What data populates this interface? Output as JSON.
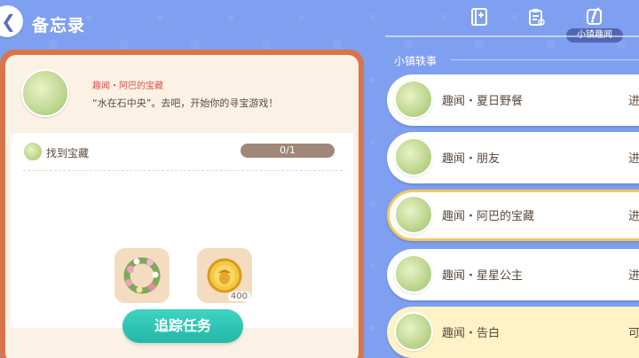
{
  "header": {
    "title": "备忘录",
    "tabs": [
      {
        "icon": "notebook-icon"
      },
      {
        "icon": "clipboard-icon"
      },
      {
        "icon": "note-check-icon",
        "label": "小镇趣闻",
        "active": true
      }
    ]
  },
  "quest": {
    "title": "趣闻・阿巴的宝藏",
    "description": "“水在石中央”。去吧，开始你的寻宝游戏！",
    "task": {
      "label": "找到宝藏",
      "progress": "0/1"
    },
    "rewards": [
      {
        "icon": "flower-wreath-icon",
        "count": ""
      },
      {
        "icon": "gold-acorn-coin-icon",
        "count": "400"
      }
    ],
    "track_button": "追踪任务"
  },
  "list": {
    "section_title": "小镇轶事",
    "items": [
      {
        "label": "趣闻・夏日野餐",
        "status": "进"
      },
      {
        "label": "趣闻・朋友",
        "status": "进"
      },
      {
        "label": "趣闻・阿巴的宝藏",
        "status": "进",
        "selected": true
      },
      {
        "label": "趣闻・星星公主",
        "status": "进"
      },
      {
        "label": "趣闻・告白",
        "status": "可"
      }
    ]
  },
  "colors": {
    "background": "#7f9ff0",
    "card_border": "#d9754a",
    "button": "#22b8a7",
    "selected_border": "#f3c95a",
    "quest_title": "#e0524a"
  }
}
